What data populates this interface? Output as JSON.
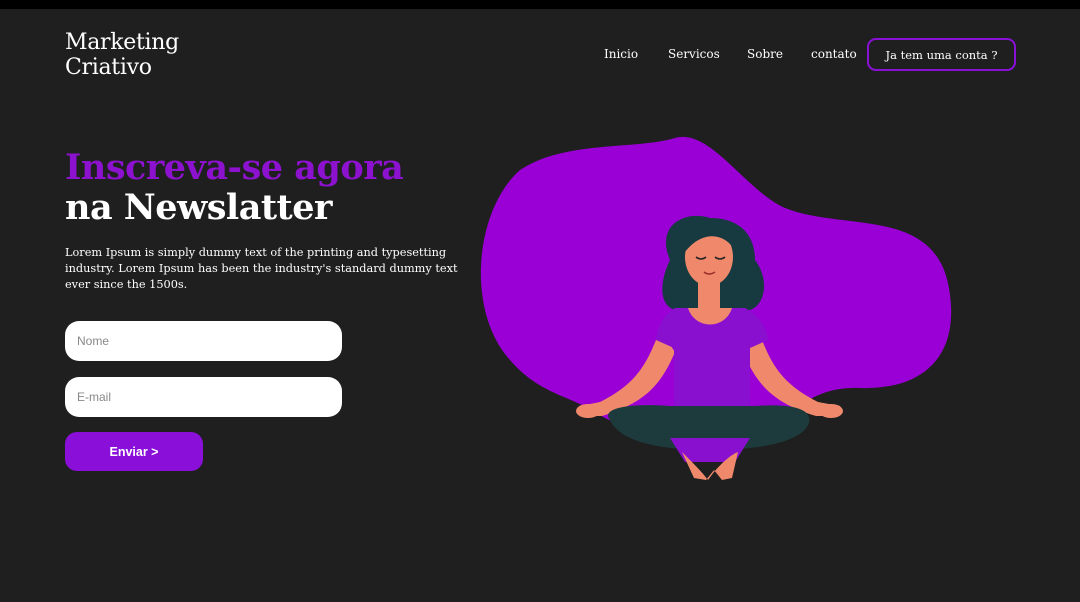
{
  "header": {
    "logo_line1": "Marketing",
    "logo_line2": "Criativo",
    "nav": {
      "inicio": "Inicio",
      "servicos": "Servicos",
      "sobre": "Sobre",
      "contato": "contato"
    },
    "login_label": "Ja tem uma conta ?"
  },
  "hero": {
    "headline_line1": "Inscreva-se agora",
    "headline_line2": "na Newslatter",
    "description": "Lorem Ipsum is simply dummy text of the printing and typesetting industry. Lorem Ipsum has been the industry's standard dummy text ever since the 1500s.",
    "name_placeholder": "Nome",
    "email_placeholder": "E-mail",
    "submit_label": "Enviar >"
  },
  "colors": {
    "background": "#1f1f1f",
    "accent_purple": "#8d12cf",
    "blob": "#9a00d6",
    "skin": "#f0896b",
    "hair": "#163a3f",
    "legs": "#1d3a3c"
  },
  "illustration": {
    "icon": "meditating-woman-illustration"
  }
}
